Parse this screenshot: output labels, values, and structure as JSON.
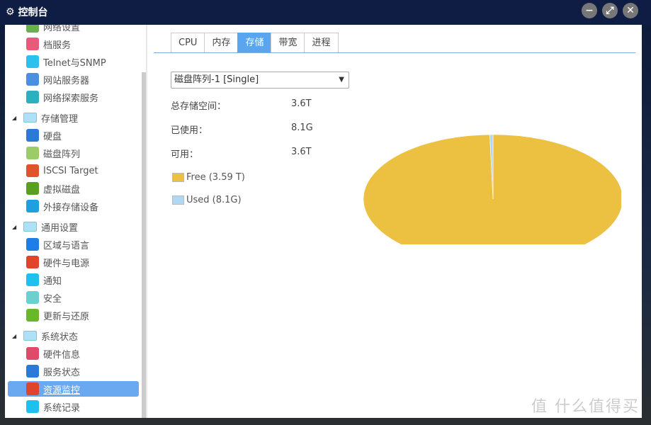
{
  "window": {
    "title": "控制台",
    "controls": [
      "minimize",
      "maximize",
      "close"
    ]
  },
  "sidebar": {
    "items_top": [
      {
        "label": "网络设置",
        "icon": "globe-icon",
        "color": "#6ab04c"
      },
      {
        "label": "档服务",
        "icon": "file-service-icon",
        "color": "#e85a7a"
      },
      {
        "label": "Telnet与SNMP",
        "icon": "monitor-icon",
        "color": "#2bc0f0"
      },
      {
        "label": "网站服务器",
        "icon": "web-server-icon",
        "color": "#4a90e2"
      },
      {
        "label": "网络探索服务",
        "icon": "network-discovery-icon",
        "color": "#2bb0c0"
      }
    ],
    "groups": [
      {
        "label": "存储管理",
        "items": [
          {
            "label": "硬盘",
            "icon": "hard-disk-icon",
            "color": "#2a7ad8"
          },
          {
            "label": "磁盘阵列",
            "icon": "disk-array-icon",
            "color": "#9ccc65"
          },
          {
            "label": "ISCSI Target",
            "icon": "iscsi-icon",
            "color": "#e0542a"
          },
          {
            "label": "虚拟磁盘",
            "icon": "virtual-disk-icon",
            "color": "#5aa020"
          },
          {
            "label": "外接存储设备",
            "icon": "external-storage-icon",
            "color": "#1ea0e0"
          }
        ]
      },
      {
        "label": "通用设置",
        "items": [
          {
            "label": "区域与语言",
            "icon": "gear-icon",
            "color": "#1e7ee8"
          },
          {
            "label": "硬件与电源",
            "icon": "power-icon",
            "color": "#e0442a"
          },
          {
            "label": "通知",
            "icon": "notification-icon",
            "color": "#1ec0f0"
          },
          {
            "label": "安全",
            "icon": "security-icon",
            "color": "#6ad0d0"
          },
          {
            "label": "更新与还原",
            "icon": "refresh-icon",
            "color": "#6ab82a"
          }
        ]
      },
      {
        "label": "系统状态",
        "items": [
          {
            "label": "硬件信息",
            "icon": "hardware-info-icon",
            "color": "#e04a6a"
          },
          {
            "label": "服务状态",
            "icon": "service-status-icon",
            "color": "#2a7ad8"
          },
          {
            "label": "资源监控",
            "icon": "resource-monitor-icon",
            "color": "#e0442a",
            "active": true
          },
          {
            "label": "系统记录",
            "icon": "system-log-icon",
            "color": "#1ec0f0"
          }
        ]
      }
    ]
  },
  "tabs": [
    {
      "label": "CPU"
    },
    {
      "label": "内存"
    },
    {
      "label": "存储",
      "active": true
    },
    {
      "label": "带宽"
    },
    {
      "label": "进程"
    }
  ],
  "storage": {
    "volume_select": "磁盘阵列-1 [Single]",
    "rows": [
      {
        "label": "总存储空间：",
        "value": "3.6T"
      },
      {
        "label": "已使用：",
        "value": "8.1G"
      },
      {
        "label": "可用：",
        "value": "3.6T"
      }
    ],
    "legend": [
      {
        "label": "Free (3.59 T)",
        "color": "#ecc040"
      },
      {
        "label": "Used (8.1G)",
        "color": "#b0d8f4"
      }
    ]
  },
  "chart_data": {
    "type": "pie",
    "slices": [
      {
        "label": "Free",
        "value_gb": 3676,
        "color": "#ecc040"
      },
      {
        "label": "Used",
        "value_gb": 8.1,
        "color": "#b0d8f4"
      }
    ]
  },
  "watermark": "值 什么值得买"
}
